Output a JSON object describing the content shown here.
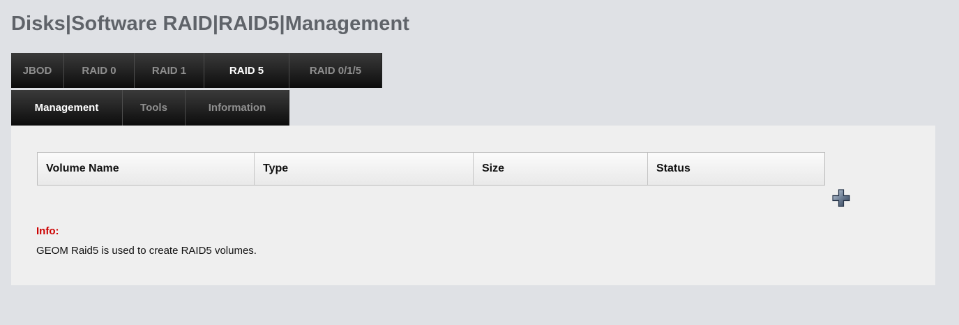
{
  "page": {
    "title": "Disks|Software RAID|RAID5|Management"
  },
  "tabs_primary": [
    {
      "label": "JBOD",
      "active": false
    },
    {
      "label": "RAID 0",
      "active": false
    },
    {
      "label": "RAID 1",
      "active": false
    },
    {
      "label": "RAID 5",
      "active": true
    },
    {
      "label": "RAID 0/1/5",
      "active": false
    }
  ],
  "tabs_secondary": [
    {
      "label": "Management",
      "active": true
    },
    {
      "label": "Tools",
      "active": false
    },
    {
      "label": "Information",
      "active": false
    }
  ],
  "table": {
    "columns": [
      "Volume Name",
      "Type",
      "Size",
      "Status"
    ],
    "rows": []
  },
  "actions": {
    "add_icon": "plus-icon"
  },
  "info": {
    "label": "Info:",
    "text": "GEOM Raid5 is used to create RAID5 volumes."
  },
  "colors": {
    "page_background": "#dfe1e5",
    "title": "#5f6369",
    "tab_active_text": "#ffffff",
    "tab_inactive_text": "#8f8f8f",
    "info_label": "#cc0000"
  }
}
